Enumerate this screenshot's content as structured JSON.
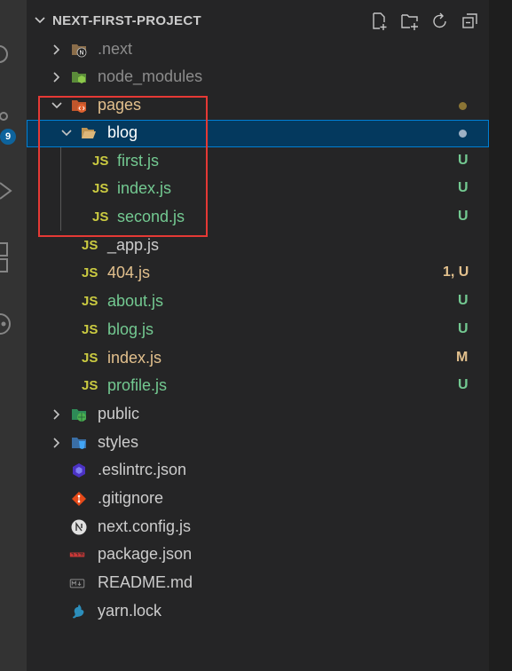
{
  "explorer": {
    "title": "NEXT-FIRST-PROJECT",
    "actions": [
      "new-file-icon",
      "new-folder-icon",
      "refresh-icon",
      "collapse-all-icon"
    ]
  },
  "activity": {
    "badge": "9"
  },
  "colors": {
    "untracked": "#73c991",
    "modified": "#e2c08d",
    "ignored": "#8c8c8c",
    "error": "#e2c08d",
    "default": "#cccccc",
    "js_icon": "#cbcb41"
  },
  "tree": [
    {
      "label": ".next",
      "status": ""
    },
    {
      "label": "node_modules",
      "status": ""
    },
    {
      "label": "pages",
      "status": ""
    },
    {
      "label": "blog",
      "status": ""
    },
    {
      "label": "first.js",
      "status": "U"
    },
    {
      "label": "index.js",
      "status": "U"
    },
    {
      "label": "second.js",
      "status": "U"
    },
    {
      "label": "_app.js",
      "status": ""
    },
    {
      "label": "404.js",
      "status": "1, U"
    },
    {
      "label": "about.js",
      "status": "U"
    },
    {
      "label": "blog.js",
      "status": "U"
    },
    {
      "label": "index.js",
      "status": "M"
    },
    {
      "label": "profile.js",
      "status": "U"
    },
    {
      "label": "public",
      "status": ""
    },
    {
      "label": "styles",
      "status": ""
    },
    {
      "label": ".eslintrc.json",
      "status": ""
    },
    {
      "label": ".gitignore",
      "status": ""
    },
    {
      "label": "next.config.js",
      "status": ""
    },
    {
      "label": "package.json",
      "status": ""
    },
    {
      "label": "README.md",
      "status": ""
    },
    {
      "label": "yarn.lock",
      "status": ""
    }
  ],
  "js_badge": "JS"
}
